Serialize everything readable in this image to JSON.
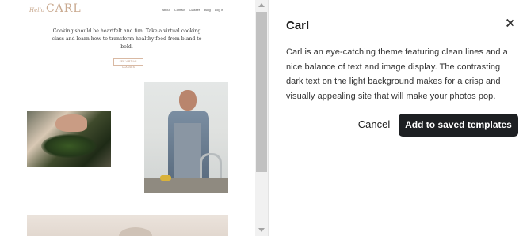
{
  "preview": {
    "logo_script": "Hello",
    "logo_text": "CARL",
    "nav": [
      "About",
      "Contact",
      "Classes",
      "Blog",
      "Log In"
    ],
    "tagline": "Cooking should be heartfelt and fun. Take a virtual cooking class and learn how to transform healthy food from bland to bold.",
    "cta": "SEE VIRTUAL CLASSES"
  },
  "panel": {
    "title": "Carl",
    "description": "Carl is an eye-catching theme featuring clean lines and a nice balance of text and image display. The contrasting dark text on the light background makes for a crisp and visually appealing site that will make your photos pop.",
    "cancel_label": "Cancel",
    "save_label": "Add to saved templates"
  },
  "colors": {
    "primary_button_bg": "#1d1f22",
    "accent": "#c9a98f"
  },
  "icons": {
    "close": "close-icon"
  }
}
